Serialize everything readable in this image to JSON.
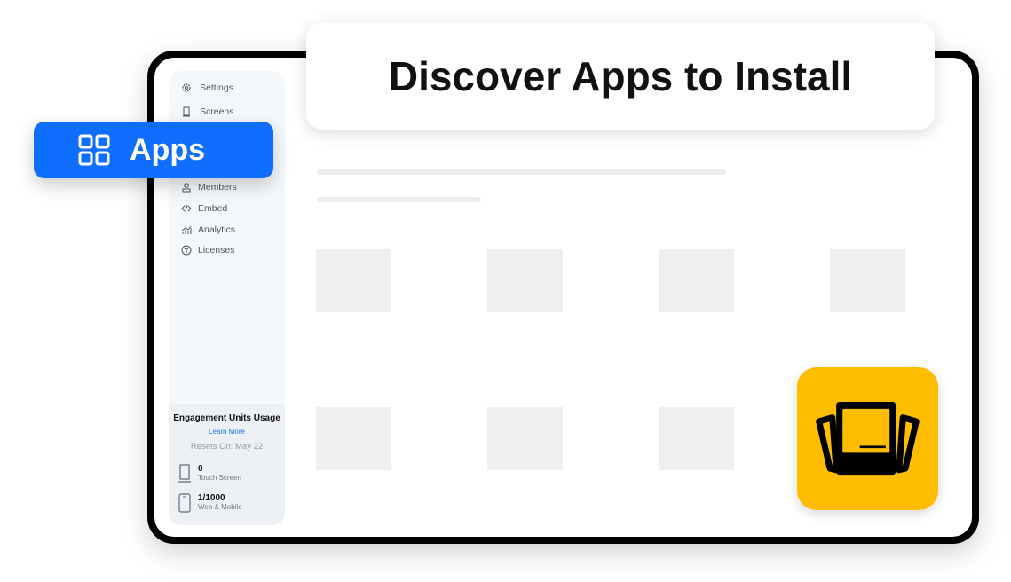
{
  "title_card": {
    "title": "Discover Apps to Install"
  },
  "apps_button": {
    "label": "Apps",
    "icon": "grid-icon",
    "color": "#0f6efd"
  },
  "sidebar": {
    "items": [
      {
        "label": "Settings",
        "icon": "gear-icon"
      },
      {
        "label": "Screens",
        "icon": "screen-icon"
      },
      {
        "label": "Members",
        "icon": "user-icon"
      },
      {
        "label": "Embed",
        "icon": "code-icon"
      },
      {
        "label": "Analytics",
        "icon": "analytics-icon"
      },
      {
        "label": "Licenses",
        "icon": "arrow-up-circle-icon"
      }
    ],
    "usage": {
      "title": "Engagement Units Usage",
      "learn_more": "Learn More",
      "resets": "Resets On: May 22",
      "stats": [
        {
          "value": "0",
          "label": "Touch Screen",
          "icon": "touch-screen-icon"
        },
        {
          "value": "1/1000",
          "label": "Web & Mobile",
          "icon": "mobile-icon"
        }
      ]
    }
  },
  "app_icon": {
    "icon": "screens-app-icon",
    "color": "#ffbd00"
  }
}
